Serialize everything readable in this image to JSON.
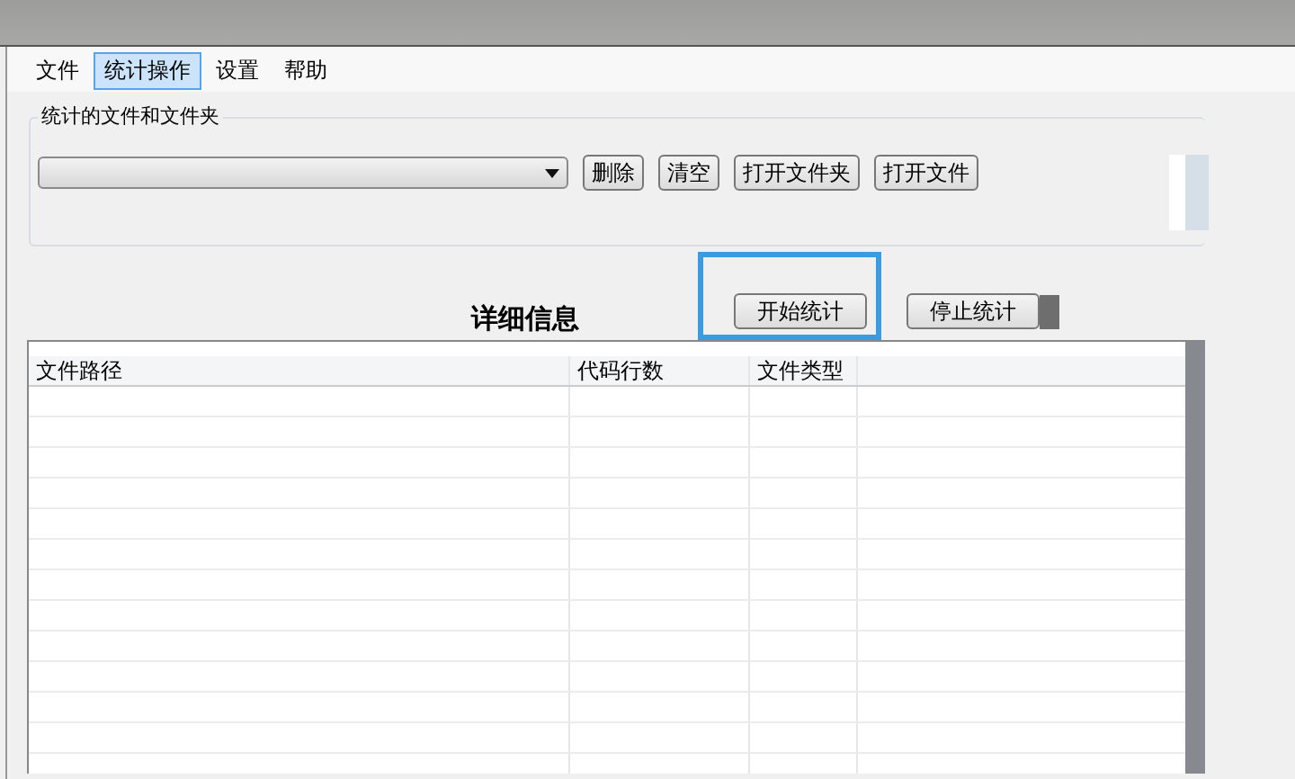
{
  "menu": [
    {
      "label": "文件",
      "selected": false
    },
    {
      "label": "统计操作",
      "selected": true
    },
    {
      "label": "设置",
      "selected": false
    },
    {
      "label": "帮助",
      "selected": false
    }
  ],
  "file_group": {
    "title": "统计的文件和文件夹",
    "buttons": [
      "删除",
      "清空",
      "打开文件夹",
      "打开文件"
    ]
  },
  "details": {
    "title": "详细信息",
    "buttons": [
      {
        "label": "开始统计",
        "highlighted": true
      },
      {
        "label": "停止统计",
        "highlighted": false
      }
    ]
  },
  "table": {
    "columns": [
      "文件路径",
      "代码行数",
      "文件类型"
    ]
  }
}
